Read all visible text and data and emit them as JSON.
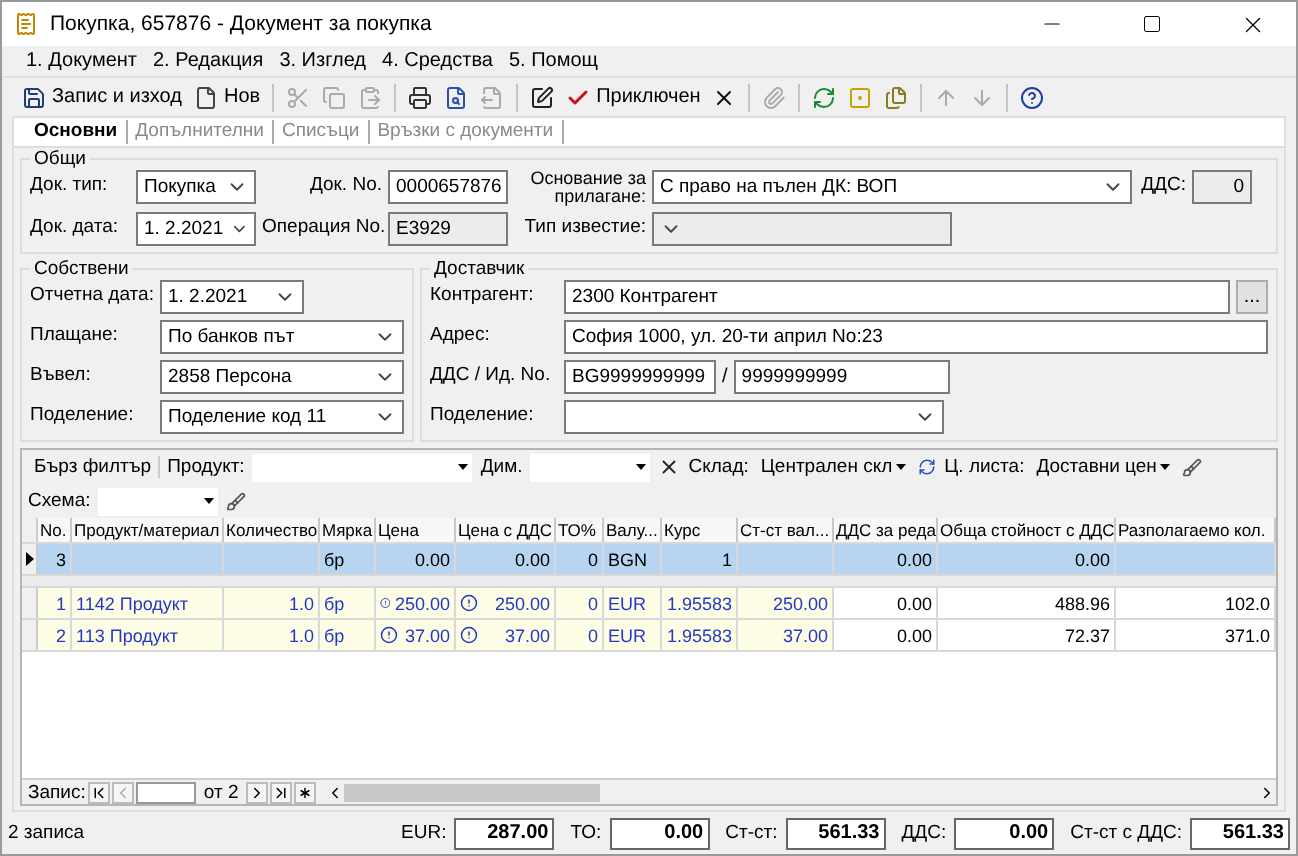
{
  "window": {
    "title": "Покупка, 657876 - Документ за покупка"
  },
  "menu": [
    {
      "label": "1. Документ"
    },
    {
      "label": "2. Редакция"
    },
    {
      "label": "3. Изглед"
    },
    {
      "label": "4. Средства"
    },
    {
      "label": "5. Помощ"
    }
  ],
  "toolbar": [
    {
      "kind": "save",
      "label": "Запис и изход",
      "disabled": false
    },
    {
      "kind": "new",
      "label": "Нов",
      "disabled": false
    },
    {
      "kind": "separator"
    },
    {
      "kind": "cut",
      "disabled": true
    },
    {
      "kind": "copy",
      "disabled": true
    },
    {
      "kind": "paste",
      "disabled": true
    },
    {
      "kind": "separator"
    },
    {
      "kind": "print",
      "disabled": false
    },
    {
      "kind": "preview",
      "disabled": false
    },
    {
      "kind": "export",
      "disabled": true
    },
    {
      "kind": "separator"
    },
    {
      "kind": "edit",
      "disabled": false
    },
    {
      "kind": "complete",
      "label": "Приключен",
      "disabled": false
    },
    {
      "kind": "delete",
      "disabled": false
    },
    {
      "kind": "separator"
    },
    {
      "kind": "attach",
      "disabled": true
    },
    {
      "kind": "separator"
    },
    {
      "kind": "refresh",
      "disabled": false
    },
    {
      "kind": "frame",
      "disabled": false
    },
    {
      "kind": "pages",
      "disabled": false
    },
    {
      "kind": "separator"
    },
    {
      "kind": "up",
      "disabled": true
    },
    {
      "kind": "down",
      "disabled": true
    },
    {
      "kind": "separator"
    },
    {
      "kind": "help",
      "disabled": false
    }
  ],
  "tabs": [
    {
      "label": "Основни",
      "selected": true
    },
    {
      "label": "Допълнителни",
      "selected": false
    },
    {
      "label": "Списъци",
      "selected": false
    },
    {
      "label": "Връзки с документи",
      "selected": false
    }
  ],
  "general": {
    "title": "Общи",
    "doc_type": {
      "label": "Док. тип:",
      "value": "Покупка"
    },
    "doc_date": {
      "label": "Док. дата:",
      "value": "1.  2.2021"
    },
    "doc_no": {
      "label": "Док. No.",
      "value": "0000657876",
      "disabled": false
    },
    "operation_no": {
      "label": "Операция No.",
      "value": "E3929",
      "disabled": true
    },
    "basis": {
      "label": "Основание за прилагане:",
      "value": "С право на пълен ДК: ВОП",
      "disabled": false
    },
    "notice_type": {
      "label": "Тип известие:",
      "disabled": true
    },
    "vat": {
      "label": "ДДС:",
      "value": "0",
      "disabled": true
    }
  },
  "own": {
    "title": "Собствени",
    "fields": [
      {
        "label": "Отчетна дата:",
        "value": "1.  2.2021"
      },
      {
        "label": "Плащане:",
        "value": "По банков път"
      },
      {
        "label": "Въвел:",
        "value": "2858 Персона"
      },
      {
        "label": "Поделение:",
        "value": "Поделение код 11"
      }
    ]
  },
  "supplier": {
    "title": "Доставчик",
    "counterparty": {
      "label": "Контрагент:",
      "value": "2300 Контрагент",
      "button": "..."
    },
    "address": {
      "label": "Адрес:",
      "value": "София 1000, ул. 20-ти април No:23"
    },
    "vat_id": {
      "label": "ДДС / Ид. No.",
      "vat": "BG9999999999",
      "separator": "/",
      "id": "9999999999"
    },
    "division": {
      "label": "Поделение:"
    }
  },
  "filter": {
    "button": "Бърз филтър",
    "product": {
      "label": "Продукт:"
    },
    "dim": {
      "label": "Дим."
    },
    "warehouse": {
      "label": "Склад:",
      "value": "Централен скл"
    },
    "price_list": {
      "label": "Ц. листа:",
      "value": "Доставни цен"
    },
    "scheme": {
      "label": "Схема:"
    }
  },
  "table": {
    "columns": [
      "No.",
      "Продукт/материал",
      "Количество",
      "Мярка",
      "Цена",
      "Цена с ДДС",
      "ТО%",
      "Валу...",
      "Курс",
      "Ст-ст вал...",
      "ДДС за реда",
      "Обща стойност с ДДС",
      "Разполагаемо кол."
    ],
    "new_row": {
      "selected": true,
      "flagged": false,
      "cells": [
        "3",
        "",
        "",
        "бр",
        "0.00",
        "0.00",
        "0",
        "BGN",
        "1",
        "",
        "0.00",
        "0.00",
        ""
      ]
    },
    "rows": [
      {
        "selected": false,
        "flagged": true,
        "cells": [
          "1",
          "1142 Продукт",
          "1.0",
          "бр",
          "250.00",
          "250.00",
          "0",
          "EUR",
          "1.95583",
          "250.00",
          "0.00",
          "488.96",
          "102.0"
        ]
      },
      {
        "selected": false,
        "flagged": true,
        "cells": [
          "2",
          "113 Продукт",
          "1.0",
          "бр",
          "37.00",
          "37.00",
          "0",
          "EUR",
          "1.95583",
          "37.00",
          "0.00",
          "72.37",
          "371.0"
        ]
      }
    ]
  },
  "navigator": {
    "label": "Запис:",
    "of": "от 2"
  },
  "status_bar": {
    "count": "2 записа",
    "totals": [
      {
        "label": "EUR:",
        "value": "287.00"
      },
      {
        "label": "ТО:",
        "value": "0.00"
      },
      {
        "label": "Ст-ст:",
        "value": "561.33"
      },
      {
        "label": "ДДС:",
        "value": "0.00"
      },
      {
        "label": "Ст-ст с ДДС:",
        "value": "561.33"
      }
    ]
  }
}
